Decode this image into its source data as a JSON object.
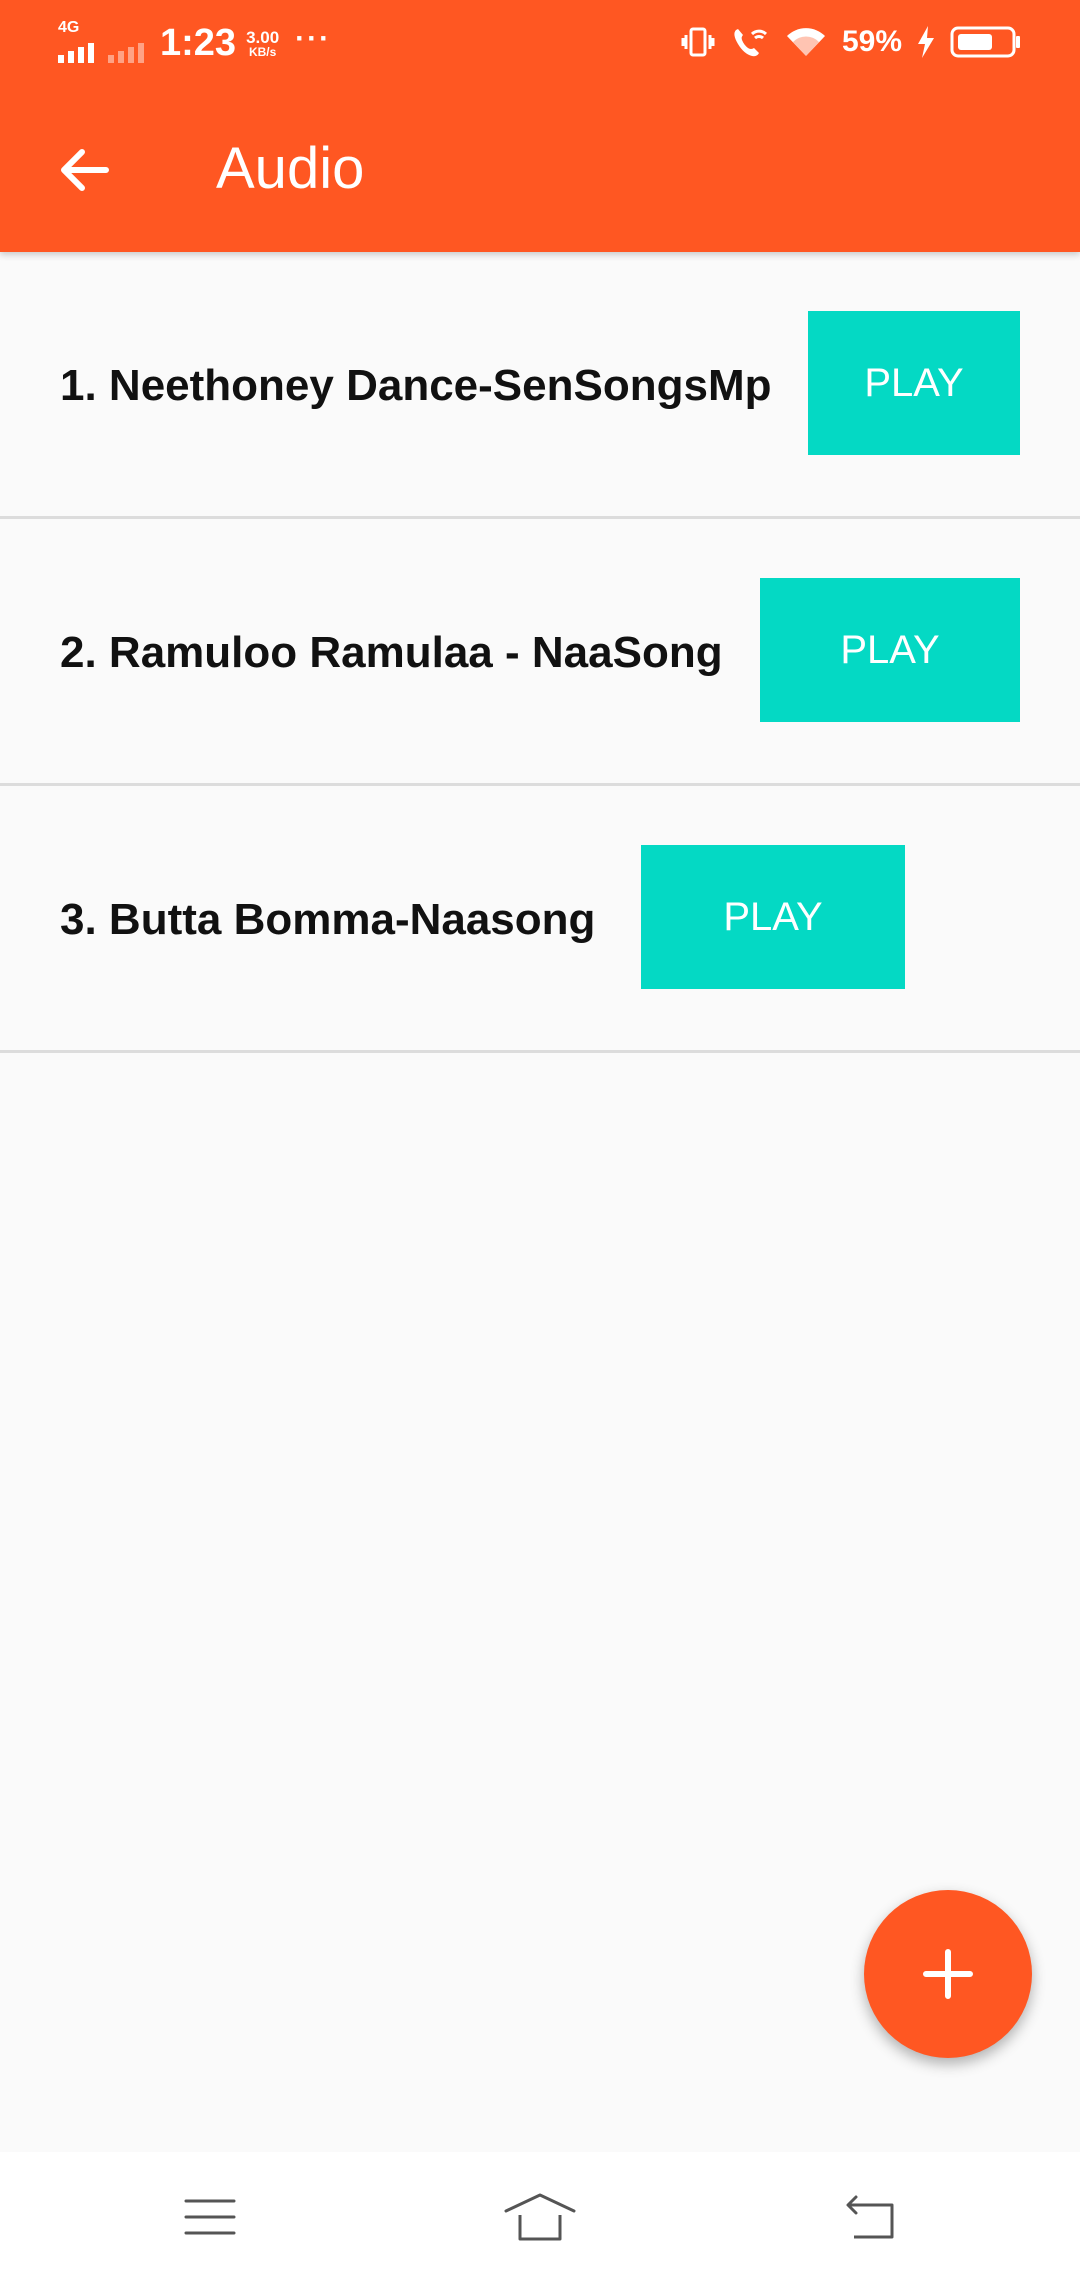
{
  "status_bar": {
    "network_type": "4G",
    "time": "1:23",
    "speed_value": "3.00",
    "speed_unit": "KB/s",
    "more": "···",
    "battery_percent": "59%",
    "icons": [
      "signal-icon",
      "vibrate-icon",
      "wifi-calling-icon",
      "wifi-icon",
      "charging-icon",
      "battery-icon"
    ]
  },
  "toolbar": {
    "title": "Audio",
    "back_icon": "arrow-left-icon"
  },
  "tracks": [
    {
      "title": "1. Neethoney Dance-SenSongsMp",
      "button": "PLAY"
    },
    {
      "title": "2. Ramuloo Ramulaa - NaaSong",
      "button": "PLAY"
    },
    {
      "title": "3. Butta Bomma-Naasong",
      "button": "PLAY"
    }
  ],
  "fab": {
    "icon": "plus-icon"
  },
  "nav_bar": {
    "icons": [
      "menu-icon",
      "home-icon",
      "back-icon"
    ]
  },
  "colors": {
    "primary": "#ff5722",
    "accent": "#04d9c4",
    "background": "#fafafa",
    "divider": "#dcdcdc"
  }
}
